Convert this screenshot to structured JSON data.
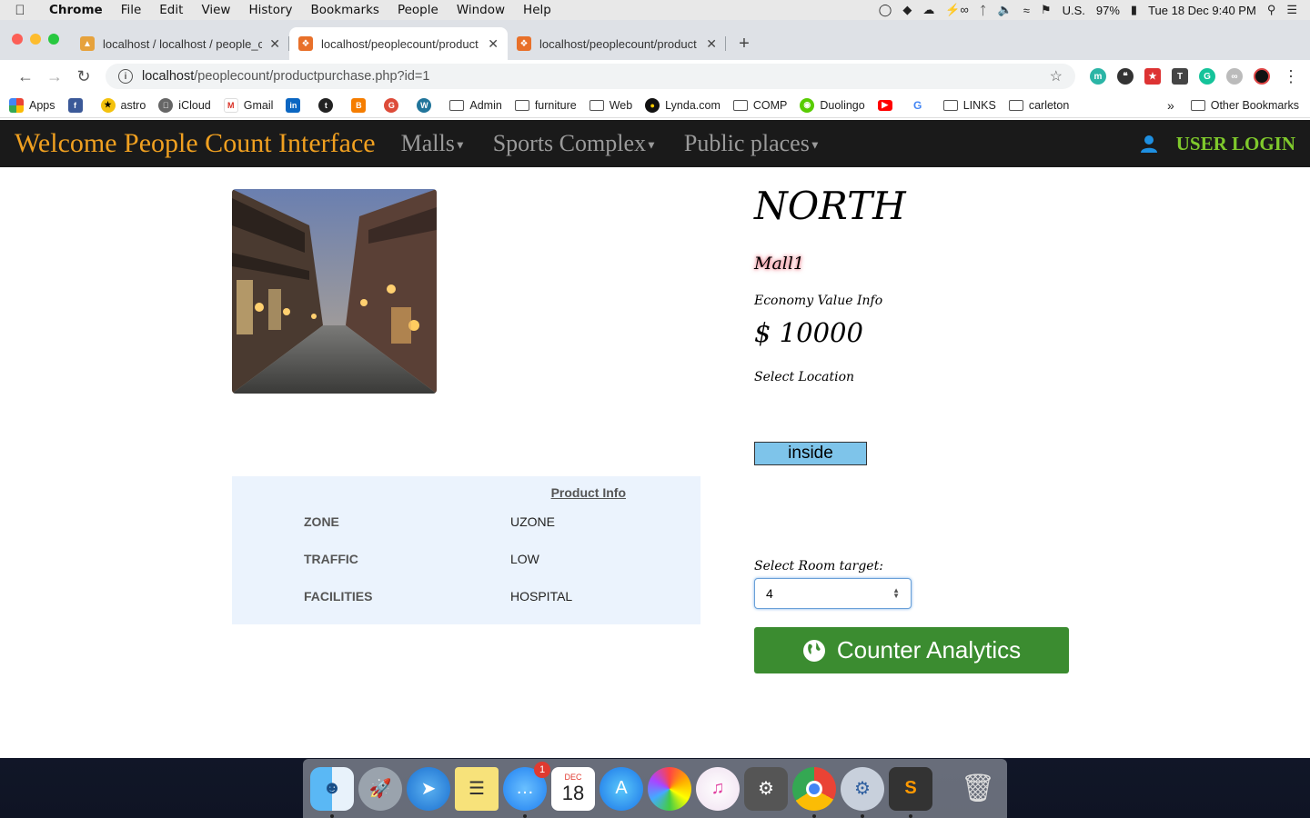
{
  "menubar": {
    "app": "Chrome",
    "items": [
      "File",
      "Edit",
      "View",
      "History",
      "Bookmarks",
      "People",
      "Window",
      "Help"
    ],
    "locale": "U.S.",
    "battery": "97%",
    "datetime": "Tue 18 Dec  9:40 PM"
  },
  "tabs": [
    {
      "title": "localhost / localhost / people_c",
      "icon": "phpmyadmin-icon"
    },
    {
      "title": "localhost/peoplecount/product",
      "icon": "xampp-icon"
    },
    {
      "title": "localhost/peoplecount/product",
      "icon": "xampp-icon"
    }
  ],
  "address": {
    "host": "localhost",
    "path": "/peoplecount/productpurchase.php?id=1"
  },
  "bookmarks": {
    "items": [
      "Apps",
      "astro",
      "iCloud",
      "Gmail",
      "Admin",
      "furniture",
      "Web",
      "Lynda.com",
      "COMP",
      "Duolingo",
      "LINKS",
      "carleton"
    ],
    "other": "Other Bookmarks",
    "overflow": "»"
  },
  "navbar": {
    "brand": "Welcome People Count Interface",
    "menus": [
      "Malls",
      "Sports Complex",
      "Public places"
    ],
    "login": "USER LOGIN"
  },
  "detail": {
    "region": "NORTH",
    "mall": "Mall1",
    "economy_label": "Economy Value Info",
    "economy_value": "$ 10000",
    "location_label": "Select Location",
    "location_value": "inside",
    "room_label": "Select Room target:",
    "room_value": "4",
    "analytics_button": "Counter Analytics"
  },
  "product_info": {
    "title": "Product Info",
    "rows": [
      {
        "key": "ZONE",
        "value": "UZONE"
      },
      {
        "key": "TRAFFIC",
        "value": "LOW"
      },
      {
        "key": "FACILITIES",
        "value": "HOSPITAL"
      }
    ]
  },
  "dock": {
    "messages_badge": "1",
    "calendar_month": "DEC",
    "calendar_day": "18"
  }
}
